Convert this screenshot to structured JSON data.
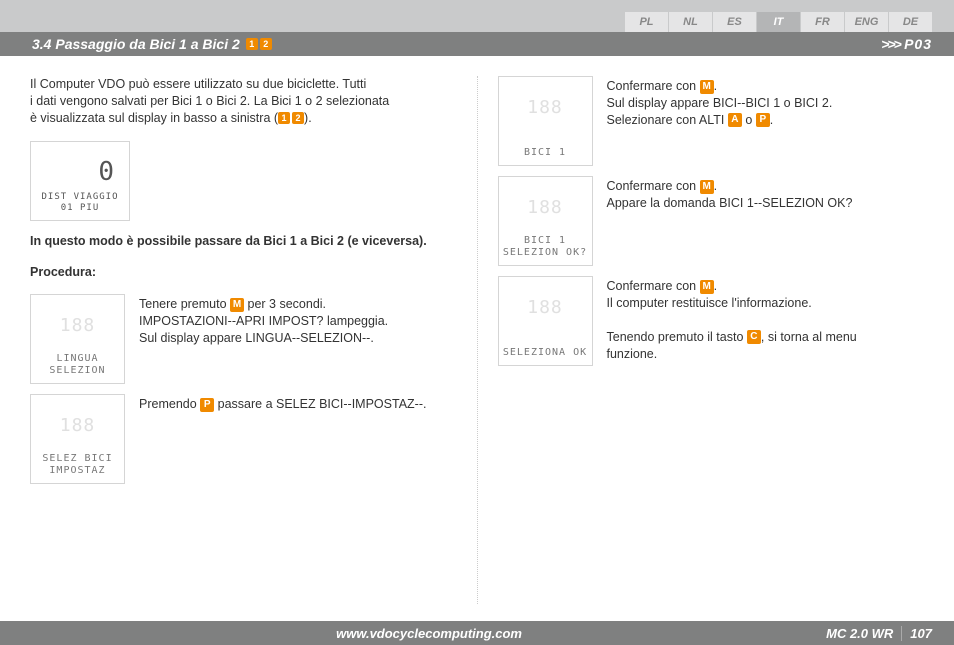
{
  "langs": {
    "items": [
      "PL",
      "NL",
      "ES",
      "IT",
      "FR",
      "ENG",
      "DE"
    ],
    "active": "IT"
  },
  "section": {
    "title": "3.4 Passaggio da Bici 1 a Bici 2",
    "badge1": "1",
    "badge2": "2",
    "page_ref": "P03",
    "arrows": ">>>"
  },
  "intro": {
    "line1": "Il Computer VDO può essere utilizzato su due biciclette. Tutti",
    "line2": "i dati vengono salvati per Bici 1 o Bici 2. La Bici 1 o 2 selezionata",
    "line3_a": "è visualizzata sul display in basso a sinistra (",
    "line3_b": ").",
    "b1": "1",
    "b2": "2"
  },
  "lcd_intro": {
    "ghost": "0",
    "text": "DIST VIAGGIO\n01 PIU"
  },
  "headline": "In questo modo è possibile passare da Bici 1 a Bici 2 (e viceversa).",
  "procedura_label": "Procedura:",
  "left_steps": [
    {
      "lcd": "LINGUA\nSELEZION",
      "pre": "Tenere premuto ",
      "btn": "M",
      "post": " per 3 secondi.",
      "line2": "IMPOSTAZIONI--APRI IMPOST? lampeggia.",
      "line3": "Sul display appare LINGUA--SELEZION--."
    },
    {
      "lcd": "SELEZ BICI\nIMPOSTAZ",
      "pre": "Premendo ",
      "btn": "P",
      "post": " passare a SELEZ BICI--IMPOSTAZ--."
    }
  ],
  "right_steps": [
    {
      "lcd": "BICI 1",
      "l1_pre": "Confermare con ",
      "l1_btn": "M",
      "l1_post": ".",
      "l2": "Sul display appare BICI--BICI 1 o BICI 2.",
      "l3_pre": "Selezionare con ALTI ",
      "l3_btn1": "A",
      "l3_mid": " o ",
      "l3_btn2": "P",
      "l3_post": "."
    },
    {
      "lcd": "BICI 1\nSELEZION OK?",
      "l1_pre": "Confermare con ",
      "l1_btn": "M",
      "l1_post": ".",
      "l2": "Appare la domanda BICI 1--SELEZION OK?"
    },
    {
      "lcd": "SELEZIONA OK",
      "l1_pre": "Confermare con ",
      "l1_btn": "M",
      "l1_post": ".",
      "l2": "Il computer restituisce l'informazione.",
      "l3_pre": "Tenendo premuto il tasto ",
      "l3_btn1": "C",
      "l3_post": ", si torna al menu",
      "l4": "funzione."
    }
  ],
  "footer": {
    "url": "www.vdocyclecomputing.com",
    "model": "MC 2.0 WR",
    "page": "107"
  }
}
